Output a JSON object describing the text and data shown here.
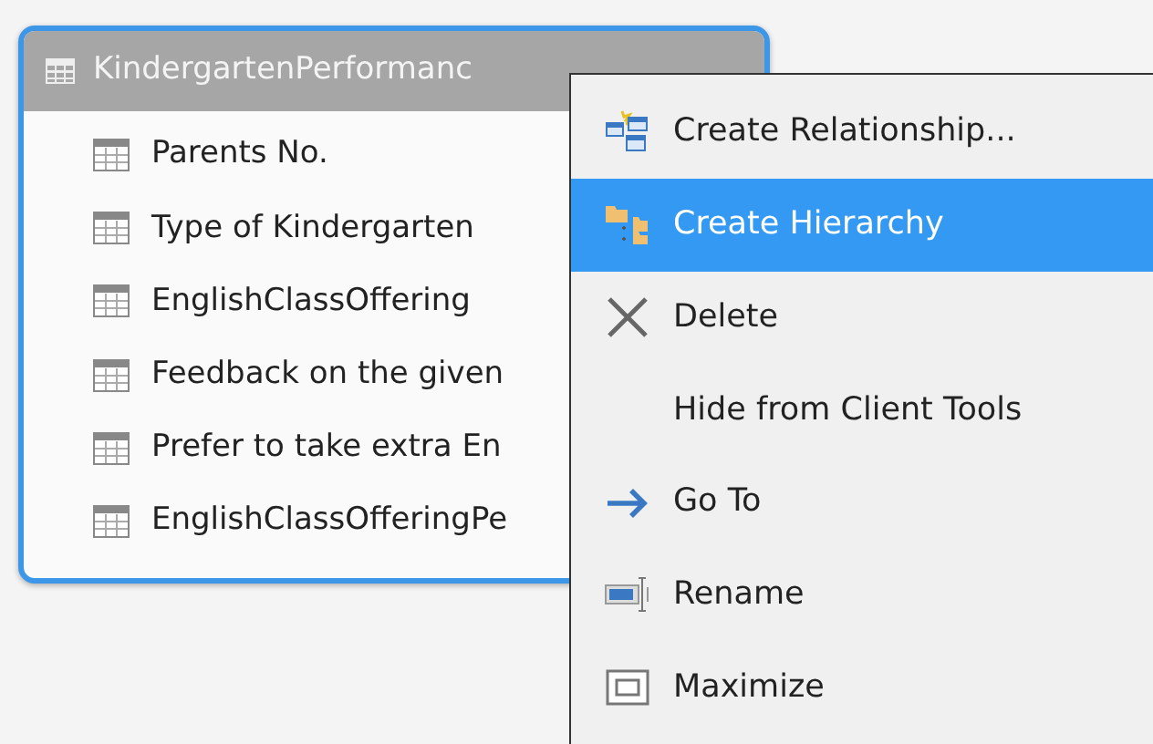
{
  "table": {
    "title": "KindergartenPerformanc",
    "columns": [
      {
        "name": "Parents No."
      },
      {
        "name": "Type of Kindergarten"
      },
      {
        "name": "EnglishClassOffering"
      },
      {
        "name": "Feedback on the given"
      },
      {
        "name": "Prefer to take extra En"
      },
      {
        "name": "EnglishClassOfferingPe"
      }
    ]
  },
  "context_menu": {
    "items": [
      {
        "kind": "relationship",
        "label": "Create Relationship...",
        "selected": false
      },
      {
        "kind": "hierarchy",
        "label": "Create Hierarchy",
        "selected": true
      },
      {
        "kind": "delete",
        "label": "Delete",
        "selected": false
      },
      {
        "kind": "none",
        "label": "Hide from Client Tools",
        "selected": false
      },
      {
        "kind": "goto",
        "label": "Go To",
        "selected": false
      },
      {
        "kind": "rename",
        "label": "Rename",
        "selected": false
      },
      {
        "kind": "maximize",
        "label": "Maximize",
        "selected": false
      }
    ]
  }
}
